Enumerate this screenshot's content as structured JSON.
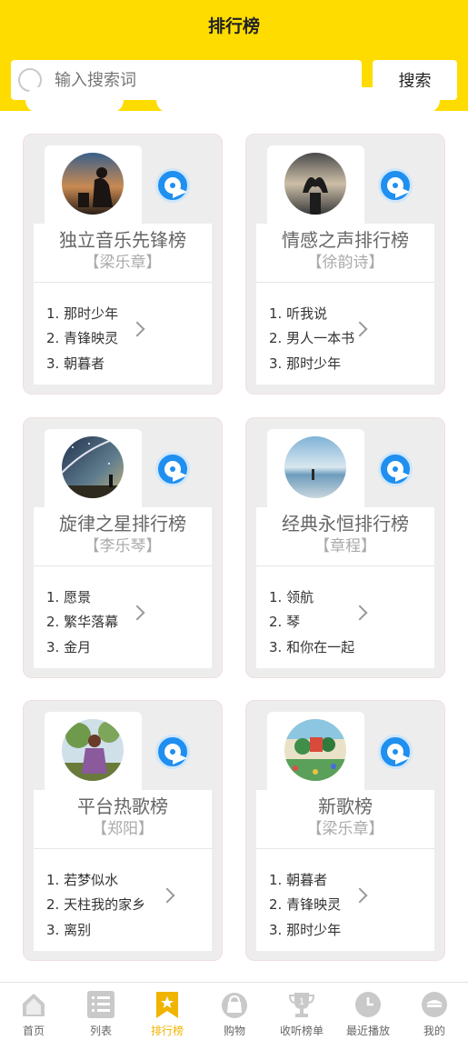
{
  "header": {
    "title": "排行榜"
  },
  "search": {
    "placeholder": "输入搜索词",
    "button_label": "搜索"
  },
  "charts": [
    {
      "name": "独立音乐先锋榜",
      "singer": "【梁乐章】",
      "songs": [
        "1. 那时少年",
        "2. 青锋映灵",
        "3. 朝暮者"
      ]
    },
    {
      "name": "情感之声排行榜",
      "singer": "【徐韵诗】",
      "songs": [
        "1. 听我说",
        "2. 男人一本书",
        "3. 那时少年"
      ]
    },
    {
      "name": "旋律之星排行榜",
      "singer": "【李乐琴】",
      "songs": [
        "1. 愿景",
        "2. 繁华落幕",
        "3. 金月"
      ]
    },
    {
      "name": "经典永恒排行榜",
      "singer": "【章程】",
      "songs": [
        "1. 领航",
        "2. 琴",
        "3. 和你在一起"
      ]
    },
    {
      "name": "平台热歌榜",
      "singer": "【郑阳】",
      "songs": [
        "1. 若梦似水",
        "2. 天柱我的家乡",
        "3. 离别"
      ]
    },
    {
      "name": "新歌榜",
      "singer": "【梁乐章】",
      "songs": [
        "1. 朝暮者",
        "2. 青锋映灵",
        "3. 那时少年"
      ]
    }
  ],
  "tabbar": [
    {
      "label": "首页",
      "icon": "home-icon"
    },
    {
      "label": "列表",
      "icon": "list-icon"
    },
    {
      "label": "排行榜",
      "icon": "star-bookmark-icon",
      "active": true
    },
    {
      "label": "购物",
      "icon": "shopping-bag-icon"
    },
    {
      "label": "收听榜单",
      "icon": "trophy-icon"
    },
    {
      "label": "最近播放",
      "icon": "clock-icon"
    },
    {
      "label": "我的",
      "icon": "user-icon"
    }
  ],
  "colors": {
    "header": "#fedc00",
    "disc": "#1f8ff0",
    "active_tab": "#f0b400"
  }
}
